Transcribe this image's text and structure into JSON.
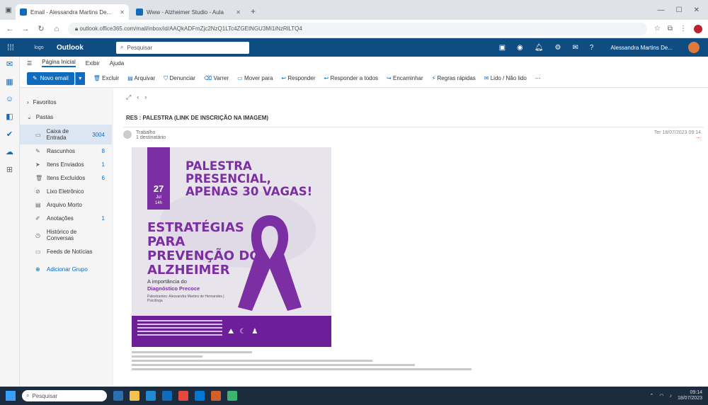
{
  "browser": {
    "tabs": [
      {
        "label": "Email - Alessandra Martins De..."
      },
      {
        "label": "Www - Alzheimer Studio - Aula"
      }
    ],
    "new_tab": "+",
    "url": "outlook.office365.com/mail/inbox/id/AAQkADFmZjc2NzQ1LTc4ZGEtNGU3Mi1iNzRlLTQ4"
  },
  "outlook": {
    "app_name": "Outlook",
    "org_logo": "logo",
    "search_placeholder": "Pesquisar",
    "user_name": "Alessandra Martins De...",
    "ribbon_tabs": [
      "Página Inicial",
      "Exibir",
      "Ajuda"
    ],
    "new_mail": "Novo email",
    "toolbar": [
      "Excluir",
      "Arquivar",
      "Denunciar",
      "Varrer",
      "Mover para",
      "Responder",
      "Responder a todos",
      "Encaminhar",
      "Regras rápidas",
      "Lido / Não lido"
    ]
  },
  "folders": {
    "favorites": "Favoritos",
    "pastas": "Pastas",
    "items": [
      {
        "label": "Caixa de Entrada",
        "count": "3004"
      },
      {
        "label": "Rascunhos",
        "count": "8"
      },
      {
        "label": "Itens Enviados",
        "count": "1"
      },
      {
        "label": "Itens Excluídos",
        "count": "6"
      },
      {
        "label": "Lixo Eletrônico",
        "count": ""
      },
      {
        "label": "Arquivo Morto",
        "count": ""
      },
      {
        "label": "Anotações",
        "count": "1"
      },
      {
        "label": "Histórico de Conversas",
        "count": ""
      },
      {
        "label": "Feeds de Notícias",
        "count": ""
      }
    ],
    "new_group": "Adicionar Grupo"
  },
  "message": {
    "subject": "RES : PALESTRA (LINK DE INSCRIÇÃO NA IMAGEM)",
    "sender": "Trabalho",
    "to": "1 destinatário",
    "date": "Ter 18/07/2023 09:14"
  },
  "flyer": {
    "date_day": "27",
    "date_month": "Jul",
    "date_time": "14h",
    "headline": [
      "PALESTRA",
      "PRESENCIAL,",
      "APENAS 30 VAGAS!"
    ],
    "title": [
      "ESTRATÉGIAS",
      "PARA",
      "PREVENÇÃO DO",
      "ALZHEIMER"
    ],
    "sub1": "A importância do",
    "sub2": "Diagnóstico Precoce",
    "sub3": "Palestrantes: Alessandra Martins de Hernandes | Psicóloga"
  },
  "taskbar": {
    "search": "Pesquisar",
    "time": "09:14",
    "date": "18/07/2023"
  }
}
